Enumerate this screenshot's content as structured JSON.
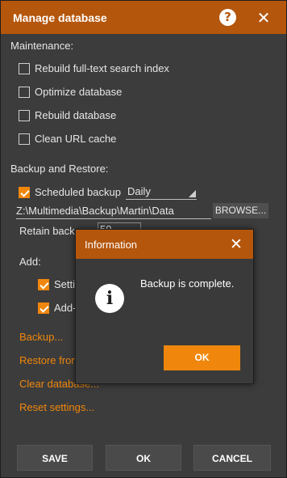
{
  "window": {
    "title": "Manage database",
    "help_icon": "question-circle-icon",
    "close_icon": "close-icon",
    "help_glyph": "?",
    "close_glyph": "✕"
  },
  "maintenance": {
    "heading": "Maintenance:",
    "items": [
      {
        "label": "Rebuild full-text search index",
        "checked": false
      },
      {
        "label": "Optimize database",
        "checked": false
      },
      {
        "label": "Rebuild database",
        "checked": false
      },
      {
        "label": "Clean URL cache",
        "checked": false
      }
    ]
  },
  "backup": {
    "heading": "Backup and Restore:",
    "scheduled_label": "Scheduled backup",
    "scheduled_checked": true,
    "schedule_value": "Daily",
    "path_value": "Z:\\Multimedia\\Backup\\Martin\\Data",
    "browse_label": "BROWSE...",
    "retain_label": "Retain backups",
    "retain_value": "50",
    "add_label": "Add:",
    "add_items": [
      {
        "label": "Settings",
        "checked": true
      },
      {
        "label": "Add-ons",
        "checked": true
      }
    ],
    "links": [
      "Backup...",
      "Restore from backup...",
      "Clear database...",
      "Reset settings..."
    ]
  },
  "buttons": {
    "save": "SAVE",
    "ok": "OK",
    "cancel": "CANCEL"
  },
  "dialog": {
    "title": "Information",
    "message": "Backup is complete.",
    "ok": "OK",
    "close_glyph": "✕",
    "info_glyph": "i"
  },
  "colors": {
    "accent": "#f0870c",
    "titlebar": "#b4560c",
    "background": "#3c3c3c"
  }
}
